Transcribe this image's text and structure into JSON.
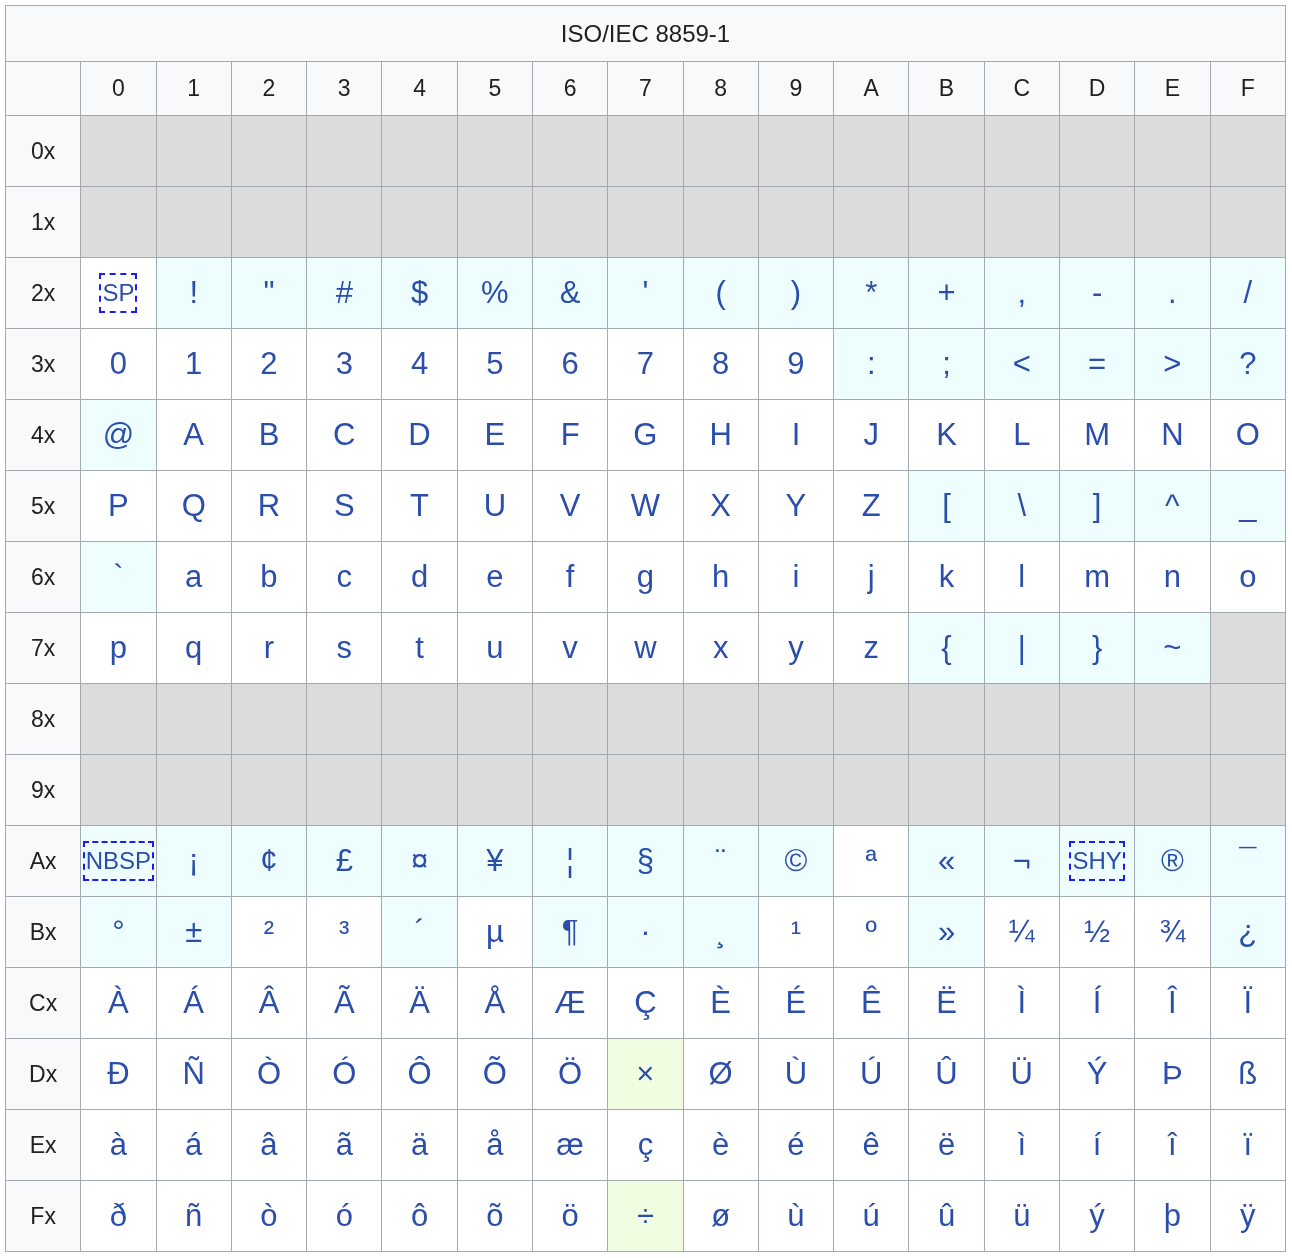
{
  "title": "ISO/IEC 8859-1",
  "columns": [
    "0",
    "1",
    "2",
    "3",
    "4",
    "5",
    "6",
    "7",
    "8",
    "9",
    "A",
    "B",
    "C",
    "D",
    "E",
    "F"
  ],
  "rows": [
    {
      "label": "0x",
      "cells": [
        {
          "kind": "control"
        },
        {
          "kind": "control"
        },
        {
          "kind": "control"
        },
        {
          "kind": "control"
        },
        {
          "kind": "control"
        },
        {
          "kind": "control"
        },
        {
          "kind": "control"
        },
        {
          "kind": "control"
        },
        {
          "kind": "control"
        },
        {
          "kind": "control"
        },
        {
          "kind": "control"
        },
        {
          "kind": "control"
        },
        {
          "kind": "control"
        },
        {
          "kind": "control"
        },
        {
          "kind": "control"
        },
        {
          "kind": "control"
        }
      ]
    },
    {
      "label": "1x",
      "cells": [
        {
          "kind": "control"
        },
        {
          "kind": "control"
        },
        {
          "kind": "control"
        },
        {
          "kind": "control"
        },
        {
          "kind": "control"
        },
        {
          "kind": "control"
        },
        {
          "kind": "control"
        },
        {
          "kind": "control"
        },
        {
          "kind": "control"
        },
        {
          "kind": "control"
        },
        {
          "kind": "control"
        },
        {
          "kind": "control"
        },
        {
          "kind": "control"
        },
        {
          "kind": "control"
        },
        {
          "kind": "control"
        },
        {
          "kind": "control"
        }
      ]
    },
    {
      "label": "2x",
      "cells": [
        {
          "char": "SP",
          "kind": "blank"
        },
        {
          "char": "!",
          "kind": "symbol"
        },
        {
          "char": "\"",
          "kind": "symbol"
        },
        {
          "char": "#",
          "kind": "symbol"
        },
        {
          "char": "$",
          "kind": "symbol"
        },
        {
          "char": "%",
          "kind": "symbol"
        },
        {
          "char": "&",
          "kind": "symbol"
        },
        {
          "char": "'",
          "kind": "symbol"
        },
        {
          "char": "(",
          "kind": "symbol"
        },
        {
          "char": ")",
          "kind": "symbol"
        },
        {
          "char": "*",
          "kind": "symbol"
        },
        {
          "char": "+",
          "kind": "symbol"
        },
        {
          "char": ",",
          "kind": "symbol"
        },
        {
          "char": "-",
          "kind": "symbol"
        },
        {
          "char": ".",
          "kind": "symbol"
        },
        {
          "char": "/",
          "kind": "symbol"
        }
      ]
    },
    {
      "label": "3x",
      "cells": [
        {
          "char": "0",
          "kind": "letter"
        },
        {
          "char": "1",
          "kind": "letter"
        },
        {
          "char": "2",
          "kind": "letter"
        },
        {
          "char": "3",
          "kind": "letter"
        },
        {
          "char": "4",
          "kind": "letter"
        },
        {
          "char": "5",
          "kind": "letter"
        },
        {
          "char": "6",
          "kind": "letter"
        },
        {
          "char": "7",
          "kind": "letter"
        },
        {
          "char": "8",
          "kind": "letter"
        },
        {
          "char": "9",
          "kind": "letter"
        },
        {
          "char": ":",
          "kind": "symbol"
        },
        {
          "char": ";",
          "kind": "symbol"
        },
        {
          "char": "<",
          "kind": "symbol"
        },
        {
          "char": "=",
          "kind": "symbol"
        },
        {
          "char": ">",
          "kind": "symbol"
        },
        {
          "char": "?",
          "kind": "symbol"
        }
      ]
    },
    {
      "label": "4x",
      "cells": [
        {
          "char": "@",
          "kind": "symbol"
        },
        {
          "char": "A",
          "kind": "letter"
        },
        {
          "char": "B",
          "kind": "letter"
        },
        {
          "char": "C",
          "kind": "letter"
        },
        {
          "char": "D",
          "kind": "letter"
        },
        {
          "char": "E",
          "kind": "letter"
        },
        {
          "char": "F",
          "kind": "letter"
        },
        {
          "char": "G",
          "kind": "letter"
        },
        {
          "char": "H",
          "kind": "letter"
        },
        {
          "char": "I",
          "kind": "letter"
        },
        {
          "char": "J",
          "kind": "letter"
        },
        {
          "char": "K",
          "kind": "letter"
        },
        {
          "char": "L",
          "kind": "letter"
        },
        {
          "char": "M",
          "kind": "letter"
        },
        {
          "char": "N",
          "kind": "letter"
        },
        {
          "char": "O",
          "kind": "letter"
        }
      ]
    },
    {
      "label": "5x",
      "cells": [
        {
          "char": "P",
          "kind": "letter"
        },
        {
          "char": "Q",
          "kind": "letter"
        },
        {
          "char": "R",
          "kind": "letter"
        },
        {
          "char": "S",
          "kind": "letter"
        },
        {
          "char": "T",
          "kind": "letter"
        },
        {
          "char": "U",
          "kind": "letter"
        },
        {
          "char": "V",
          "kind": "letter"
        },
        {
          "char": "W",
          "kind": "letter"
        },
        {
          "char": "X",
          "kind": "letter"
        },
        {
          "char": "Y",
          "kind": "letter"
        },
        {
          "char": "Z",
          "kind": "letter"
        },
        {
          "char": "[",
          "kind": "symbol"
        },
        {
          "char": "\\",
          "kind": "symbol"
        },
        {
          "char": "]",
          "kind": "symbol"
        },
        {
          "char": "^",
          "kind": "symbol"
        },
        {
          "char": "_",
          "kind": "symbol"
        }
      ]
    },
    {
      "label": "6x",
      "cells": [
        {
          "char": "`",
          "kind": "symbol"
        },
        {
          "char": "a",
          "kind": "letter"
        },
        {
          "char": "b",
          "kind": "letter"
        },
        {
          "char": "c",
          "kind": "letter"
        },
        {
          "char": "d",
          "kind": "letter"
        },
        {
          "char": "e",
          "kind": "letter"
        },
        {
          "char": "f",
          "kind": "letter"
        },
        {
          "char": "g",
          "kind": "letter"
        },
        {
          "char": "h",
          "kind": "letter"
        },
        {
          "char": "i",
          "kind": "letter"
        },
        {
          "char": "j",
          "kind": "letter"
        },
        {
          "char": "k",
          "kind": "letter"
        },
        {
          "char": "l",
          "kind": "letter"
        },
        {
          "char": "m",
          "kind": "letter"
        },
        {
          "char": "n",
          "kind": "letter"
        },
        {
          "char": "o",
          "kind": "letter"
        }
      ]
    },
    {
      "label": "7x",
      "cells": [
        {
          "char": "p",
          "kind": "letter"
        },
        {
          "char": "q",
          "kind": "letter"
        },
        {
          "char": "r",
          "kind": "letter"
        },
        {
          "char": "s",
          "kind": "letter"
        },
        {
          "char": "t",
          "kind": "letter"
        },
        {
          "char": "u",
          "kind": "letter"
        },
        {
          "char": "v",
          "kind": "letter"
        },
        {
          "char": "w",
          "kind": "letter"
        },
        {
          "char": "x",
          "kind": "letter"
        },
        {
          "char": "y",
          "kind": "letter"
        },
        {
          "char": "z",
          "kind": "letter"
        },
        {
          "char": "{",
          "kind": "symbol"
        },
        {
          "char": "|",
          "kind": "symbol"
        },
        {
          "char": "}",
          "kind": "symbol"
        },
        {
          "char": "~",
          "kind": "symbol"
        },
        {
          "kind": "control"
        }
      ]
    },
    {
      "label": "8x",
      "cells": [
        {
          "kind": "control"
        },
        {
          "kind": "control"
        },
        {
          "kind": "control"
        },
        {
          "kind": "control"
        },
        {
          "kind": "control"
        },
        {
          "kind": "control"
        },
        {
          "kind": "control"
        },
        {
          "kind": "control"
        },
        {
          "kind": "control"
        },
        {
          "kind": "control"
        },
        {
          "kind": "control"
        },
        {
          "kind": "control"
        },
        {
          "kind": "control"
        },
        {
          "kind": "control"
        },
        {
          "kind": "control"
        },
        {
          "kind": "control"
        }
      ]
    },
    {
      "label": "9x",
      "cells": [
        {
          "kind": "control"
        },
        {
          "kind": "control"
        },
        {
          "kind": "control"
        },
        {
          "kind": "control"
        },
        {
          "kind": "control"
        },
        {
          "kind": "control"
        },
        {
          "kind": "control"
        },
        {
          "kind": "control"
        },
        {
          "kind": "control"
        },
        {
          "kind": "control"
        },
        {
          "kind": "control"
        },
        {
          "kind": "control"
        },
        {
          "kind": "control"
        },
        {
          "kind": "control"
        },
        {
          "kind": "control"
        },
        {
          "kind": "control"
        }
      ]
    },
    {
      "label": "Ax",
      "cells": [
        {
          "char": "NBSP",
          "kind": "special"
        },
        {
          "char": "¡",
          "kind": "symbol"
        },
        {
          "char": "¢",
          "kind": "symbol"
        },
        {
          "char": "£",
          "kind": "symbol"
        },
        {
          "char": "¤",
          "kind": "symbol"
        },
        {
          "char": "¥",
          "kind": "symbol"
        },
        {
          "char": "¦",
          "kind": "symbol"
        },
        {
          "char": "§",
          "kind": "symbol"
        },
        {
          "char": "¨",
          "kind": "symbol"
        },
        {
          "char": "©",
          "kind": "symbol"
        },
        {
          "char": "ª",
          "kind": "letter"
        },
        {
          "char": "«",
          "kind": "symbol"
        },
        {
          "char": "¬",
          "kind": "symbol"
        },
        {
          "char": "SHY",
          "kind": "special"
        },
        {
          "char": "®",
          "kind": "symbol"
        },
        {
          "char": "¯",
          "kind": "symbol"
        }
      ]
    },
    {
      "label": "Bx",
      "cells": [
        {
          "char": "°",
          "kind": "symbol"
        },
        {
          "char": "±",
          "kind": "symbol"
        },
        {
          "char": "²",
          "kind": "letter"
        },
        {
          "char": "³",
          "kind": "letter"
        },
        {
          "char": "´",
          "kind": "symbol"
        },
        {
          "char": "µ",
          "kind": "letter"
        },
        {
          "char": "¶",
          "kind": "symbol"
        },
        {
          "char": "·",
          "kind": "symbol"
        },
        {
          "char": "¸",
          "kind": "symbol"
        },
        {
          "char": "¹",
          "kind": "letter"
        },
        {
          "char": "º",
          "kind": "letter"
        },
        {
          "char": "»",
          "kind": "symbol"
        },
        {
          "char": "¼",
          "kind": "letter"
        },
        {
          "char": "½",
          "kind": "letter"
        },
        {
          "char": "¾",
          "kind": "letter"
        },
        {
          "char": "¿",
          "kind": "symbol"
        }
      ]
    },
    {
      "label": "Cx",
      "cells": [
        {
          "char": "À",
          "kind": "letter"
        },
        {
          "char": "Á",
          "kind": "letter"
        },
        {
          "char": "Â",
          "kind": "letter"
        },
        {
          "char": "Ã",
          "kind": "letter"
        },
        {
          "char": "Ä",
          "kind": "letter"
        },
        {
          "char": "Å",
          "kind": "letter"
        },
        {
          "char": "Æ",
          "kind": "letter"
        },
        {
          "char": "Ç",
          "kind": "letter"
        },
        {
          "char": "È",
          "kind": "letter"
        },
        {
          "char": "É",
          "kind": "letter"
        },
        {
          "char": "Ê",
          "kind": "letter"
        },
        {
          "char": "Ë",
          "kind": "letter"
        },
        {
          "char": "Ì",
          "kind": "letter"
        },
        {
          "char": "Í",
          "kind": "letter"
        },
        {
          "char": "Î",
          "kind": "letter"
        },
        {
          "char": "Ï",
          "kind": "letter"
        }
      ]
    },
    {
      "label": "Dx",
      "cells": [
        {
          "char": "Ð",
          "kind": "letter"
        },
        {
          "char": "Ñ",
          "kind": "letter"
        },
        {
          "char": "Ò",
          "kind": "letter"
        },
        {
          "char": "Ó",
          "kind": "letter"
        },
        {
          "char": "Ô",
          "kind": "letter"
        },
        {
          "char": "Õ",
          "kind": "letter"
        },
        {
          "char": "Ö",
          "kind": "letter"
        },
        {
          "char": "×",
          "kind": "math"
        },
        {
          "char": "Ø",
          "kind": "letter"
        },
        {
          "char": "Ù",
          "kind": "letter"
        },
        {
          "char": "Ú",
          "kind": "letter"
        },
        {
          "char": "Û",
          "kind": "letter"
        },
        {
          "char": "Ü",
          "kind": "letter"
        },
        {
          "char": "Ý",
          "kind": "letter"
        },
        {
          "char": "Þ",
          "kind": "letter"
        },
        {
          "char": "ß",
          "kind": "letter"
        }
      ]
    },
    {
      "label": "Ex",
      "cells": [
        {
          "char": "à",
          "kind": "letter"
        },
        {
          "char": "á",
          "kind": "letter"
        },
        {
          "char": "â",
          "kind": "letter"
        },
        {
          "char": "ã",
          "kind": "letter"
        },
        {
          "char": "ä",
          "kind": "letter"
        },
        {
          "char": "å",
          "kind": "letter"
        },
        {
          "char": "æ",
          "kind": "letter"
        },
        {
          "char": "ç",
          "kind": "letter"
        },
        {
          "char": "è",
          "kind": "letter"
        },
        {
          "char": "é",
          "kind": "letter"
        },
        {
          "char": "ê",
          "kind": "letter"
        },
        {
          "char": "ë",
          "kind": "letter"
        },
        {
          "char": "ì",
          "kind": "letter"
        },
        {
          "char": "í",
          "kind": "letter"
        },
        {
          "char": "î",
          "kind": "letter"
        },
        {
          "char": "ï",
          "kind": "letter"
        }
      ]
    },
    {
      "label": "Fx",
      "cells": [
        {
          "char": "ð",
          "kind": "letter"
        },
        {
          "char": "ñ",
          "kind": "letter"
        },
        {
          "char": "ò",
          "kind": "letter"
        },
        {
          "char": "ó",
          "kind": "letter"
        },
        {
          "char": "ô",
          "kind": "letter"
        },
        {
          "char": "õ",
          "kind": "letter"
        },
        {
          "char": "ö",
          "kind": "letter"
        },
        {
          "char": "÷",
          "kind": "math"
        },
        {
          "char": "ø",
          "kind": "letter"
        },
        {
          "char": "ù",
          "kind": "letter"
        },
        {
          "char": "ú",
          "kind": "letter"
        },
        {
          "char": "û",
          "kind": "letter"
        },
        {
          "char": "ü",
          "kind": "letter"
        },
        {
          "char": "ý",
          "kind": "letter"
        },
        {
          "char": "þ",
          "kind": "letter"
        },
        {
          "char": "ÿ",
          "kind": "letter"
        }
      ]
    }
  ]
}
